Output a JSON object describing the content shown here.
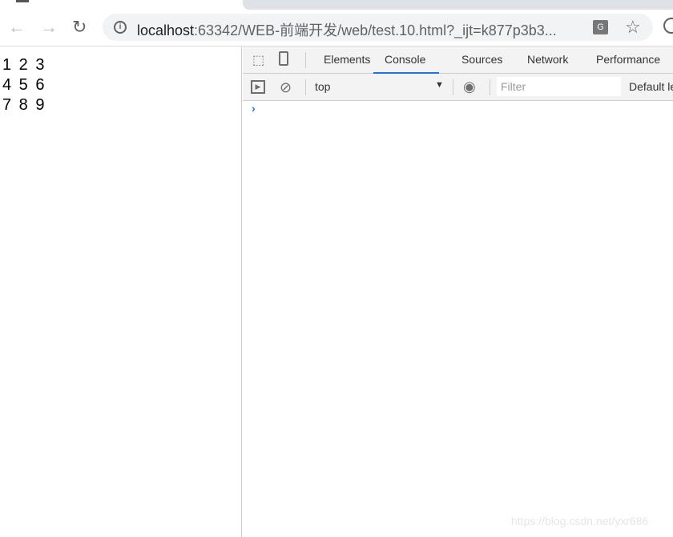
{
  "browser": {
    "url_host": "localhost",
    "url_rest": ":63342/WEB-前端开发/web/test.10.html?_ijt=k877p3b3...",
    "back_icon": "←",
    "forward_icon": "→",
    "reload_icon": "↻",
    "star_icon": "☆",
    "translate_icon": "G"
  },
  "page": {
    "rows": [
      "1 2 3",
      "4 5 6",
      "7 8 9"
    ]
  },
  "devtools": {
    "tabs": [
      "Elements",
      "Console",
      "Sources",
      "Network",
      "Performance"
    ],
    "active_tab": "Console",
    "context": "top",
    "filter_placeholder": "Filter",
    "levels": "Default levels",
    "prompt": "›"
  },
  "watermark": "https://blog.csdn.net/yxr686",
  "colors": {
    "accent": "#1a73e8"
  }
}
